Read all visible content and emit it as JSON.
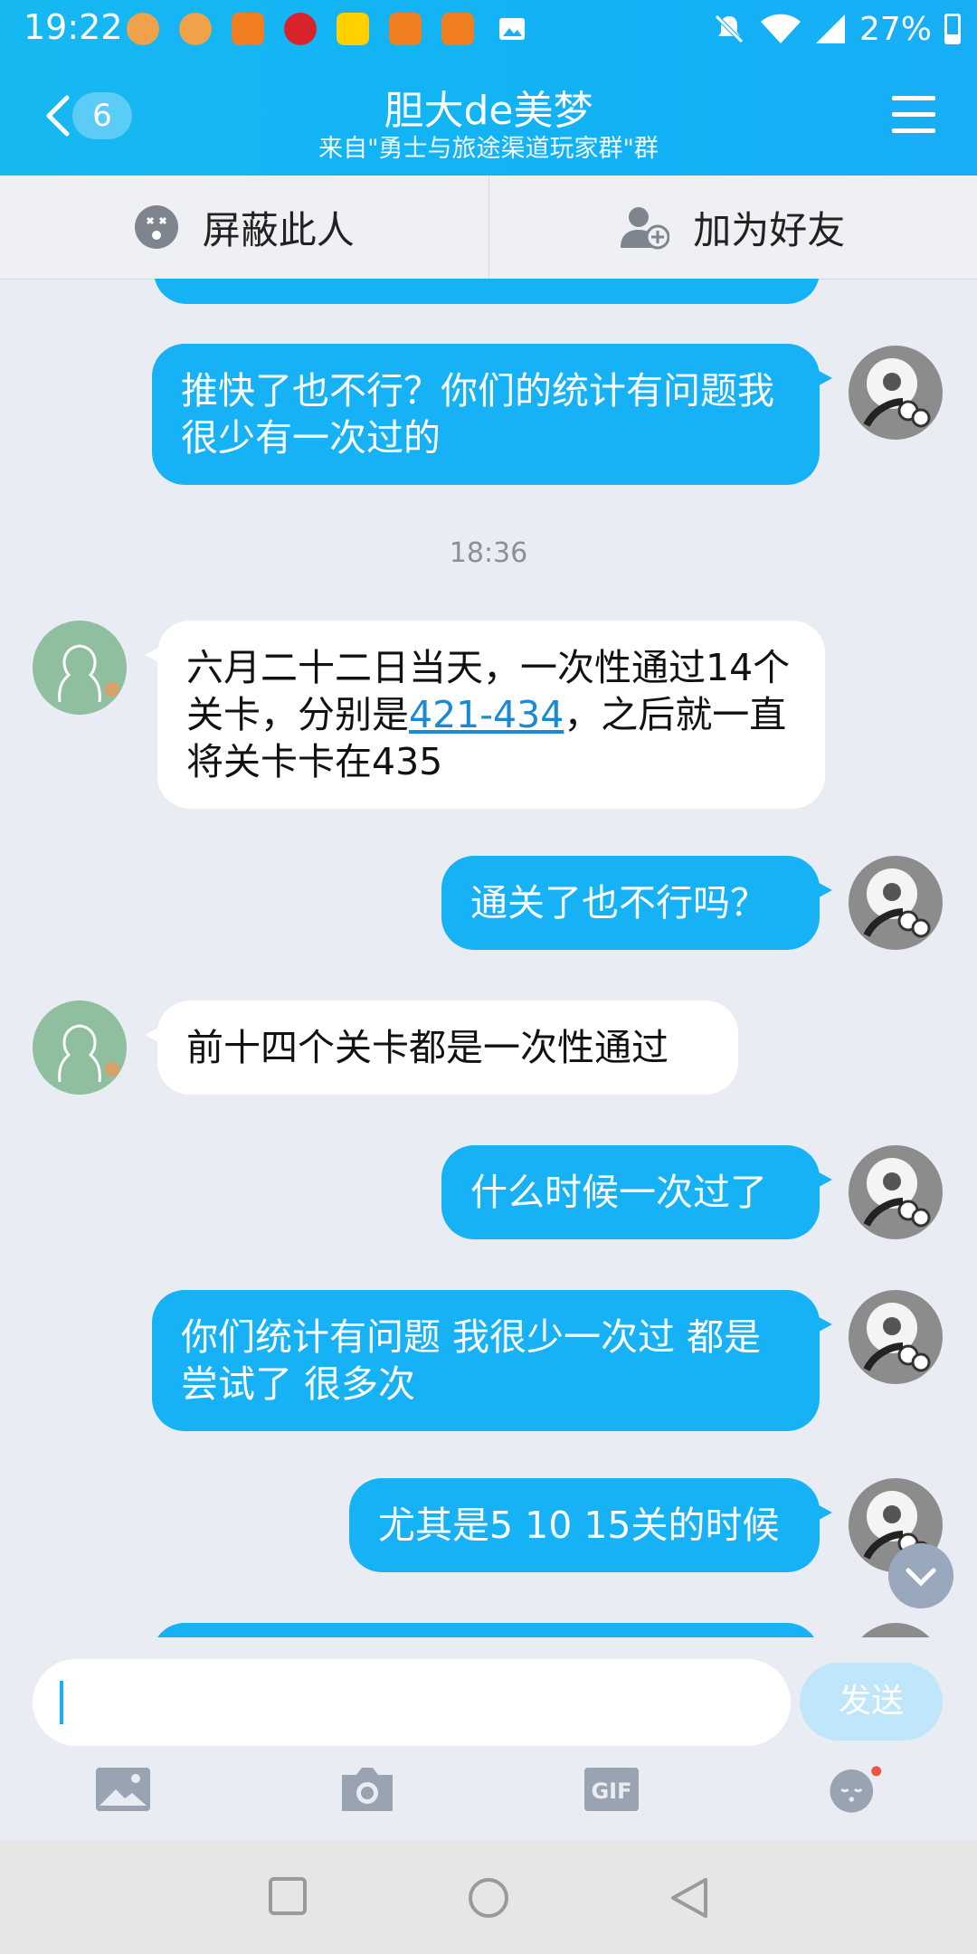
{
  "status_bar": {
    "time": "19:22",
    "battery": "27%"
  },
  "header": {
    "back_count": "6",
    "title": "胆大de美梦",
    "subtitle": "来自\"勇士与旅途渠道玩家群\"群"
  },
  "actions": {
    "block_label": "屏蔽此人",
    "add_friend_label": "加为好友"
  },
  "messages": [
    {
      "side": "me",
      "text": "推快了也不行？你们的统计有问题我很少有一次过的"
    },
    {
      "type": "timestamp",
      "text": "18:36"
    },
    {
      "side": "them",
      "text_before": "六月二十二日当天，一次性通过14个关卡，分别是",
      "link": "421-434",
      "text_after": "，之后就一直将关卡卡在435"
    },
    {
      "side": "me",
      "text": "通关了也不行吗？"
    },
    {
      "side": "them",
      "text": "前十四个关卡都是一次性通过"
    },
    {
      "side": "me",
      "text": "什么时候一次过了"
    },
    {
      "side": "me",
      "text": "你们统计有问题 我很少一次过 都是尝试了 很多次"
    },
    {
      "side": "me",
      "text": "尤其是5 10 15关的时候"
    }
  ],
  "input": {
    "placeholder": "",
    "send_label": "发送"
  },
  "toolbar": [
    "image-icon",
    "camera-icon",
    "gif-icon",
    "emoji-icon"
  ],
  "icons": {
    "toolbar_gif_text": "GIF"
  },
  "colors": {
    "header": "#16b8f2",
    "bubble_me": "#17b2f5",
    "bubble_them": "#ffffff",
    "background": "#e9ecf2"
  }
}
